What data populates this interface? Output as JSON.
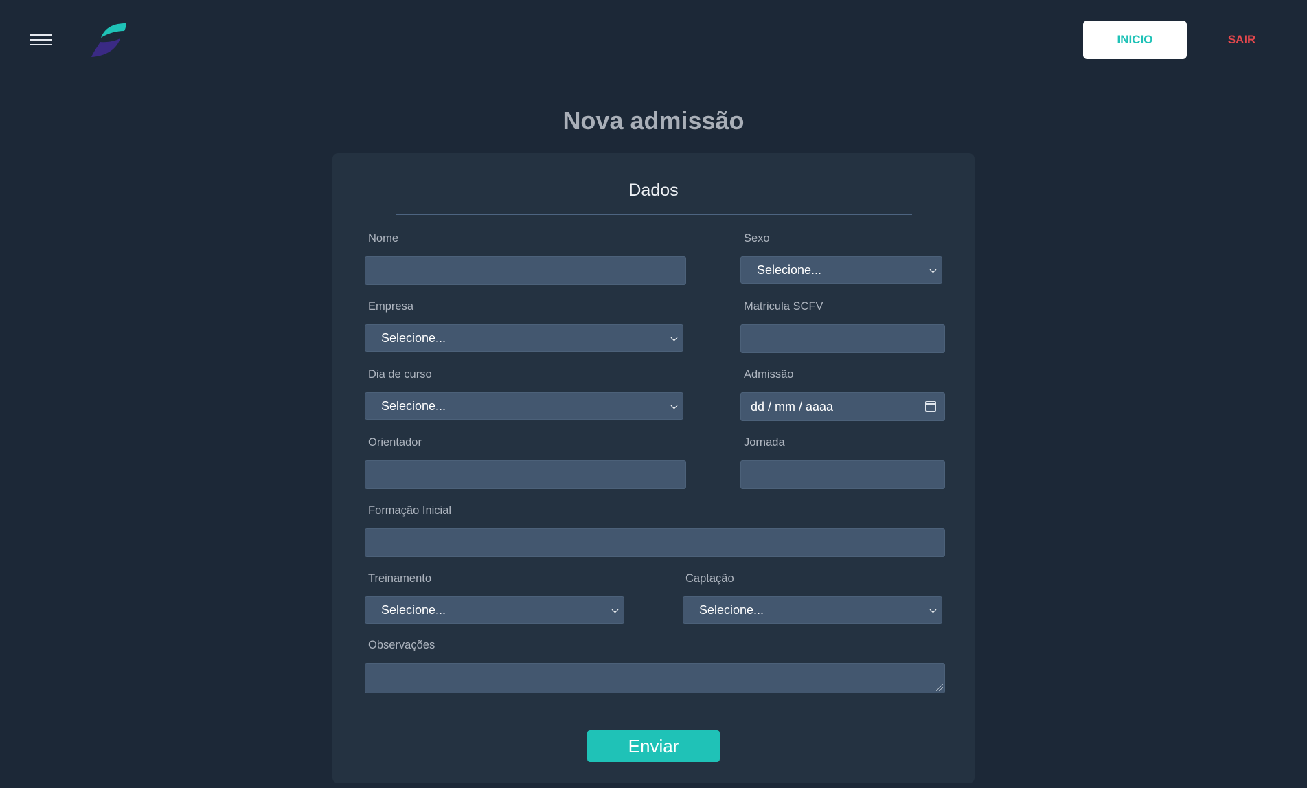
{
  "header": {
    "inicio_label": "INICIO",
    "sair_label": "SAIR",
    "menu_icon": "hamburger-menu-icon",
    "logo_icon": "app-logo-icon"
  },
  "page": {
    "title": "Nova admissão"
  },
  "form": {
    "section_title": "Dados",
    "fields": {
      "nome": {
        "label": "Nome",
        "value": ""
      },
      "sexo": {
        "label": "Sexo",
        "value": "Selecione..."
      },
      "empresa": {
        "label": "Empresa",
        "value": "Selecione..."
      },
      "matricula": {
        "label": "Matricula SCFV",
        "value": ""
      },
      "dia_curso": {
        "label": "Dia de curso",
        "value": "Selecione..."
      },
      "admissao": {
        "label": "Admissão",
        "value": "dd / mm / aaaa"
      },
      "orientador": {
        "label": "Orientador",
        "value": ""
      },
      "jornada": {
        "label": "Jornada",
        "value": ""
      },
      "formacao": {
        "label": "Formação Inicial",
        "value": ""
      },
      "treinamento": {
        "label": "Treinamento",
        "value": "Selecione..."
      },
      "captacao": {
        "label": "Captação",
        "value": "Selecione..."
      },
      "observacoes": {
        "label": "Observações",
        "value": ""
      }
    },
    "submit_label": "Enviar"
  },
  "colors": {
    "background": "#1c2837",
    "card": "#243241",
    "input": "#43576f",
    "accent": "#1fc2b7",
    "danger": "#e5484d",
    "logo_top": "#1fc2b7",
    "logo_bottom": "#3a2a84"
  }
}
